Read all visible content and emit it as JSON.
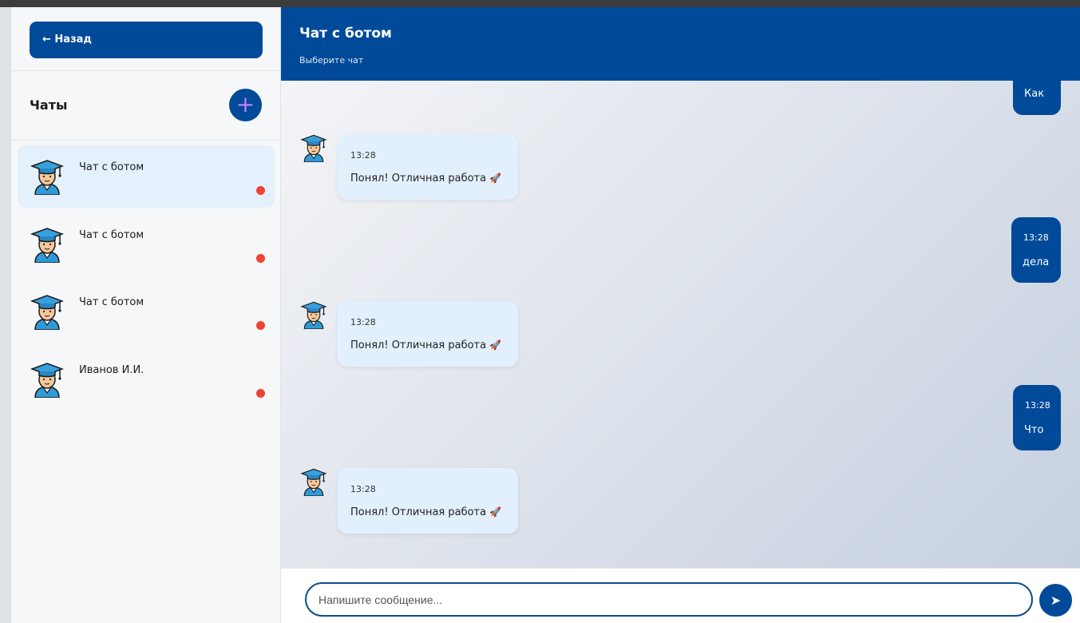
{
  "sidebar": {
    "back_label": "← Назад",
    "chats_title": "Чаты",
    "add_icon": "plus-icon",
    "chats": [
      {
        "name": "Чат с ботом",
        "active": true
      },
      {
        "name": "Чат с ботом",
        "active": false
      },
      {
        "name": "Чат с ботом",
        "active": false
      },
      {
        "name": "Иванов И.И.",
        "active": false
      }
    ]
  },
  "header": {
    "title": "Чат с ботом",
    "subtitle": "Выберите чат"
  },
  "messages": [
    {
      "from": "user",
      "time": "",
      "text": "Как"
    },
    {
      "from": "bot",
      "time": "13:28",
      "text": "Понял! Отличная работа"
    },
    {
      "from": "user",
      "time": "13:28",
      "text": "дела"
    },
    {
      "from": "bot",
      "time": "13:28",
      "text": "Понял! Отличная работа"
    },
    {
      "from": "user",
      "time": "13:28",
      "text": "Что"
    },
    {
      "from": "bot",
      "time": "13:28",
      "text": "Понял! Отличная работа"
    }
  ],
  "composer": {
    "placeholder": "Напишите сообщение...",
    "send_icon": "send-arrow-icon"
  },
  "colors": {
    "primary": "#004a99",
    "bot_bubble": "#e2f0fd",
    "unread": "#ee4433"
  }
}
